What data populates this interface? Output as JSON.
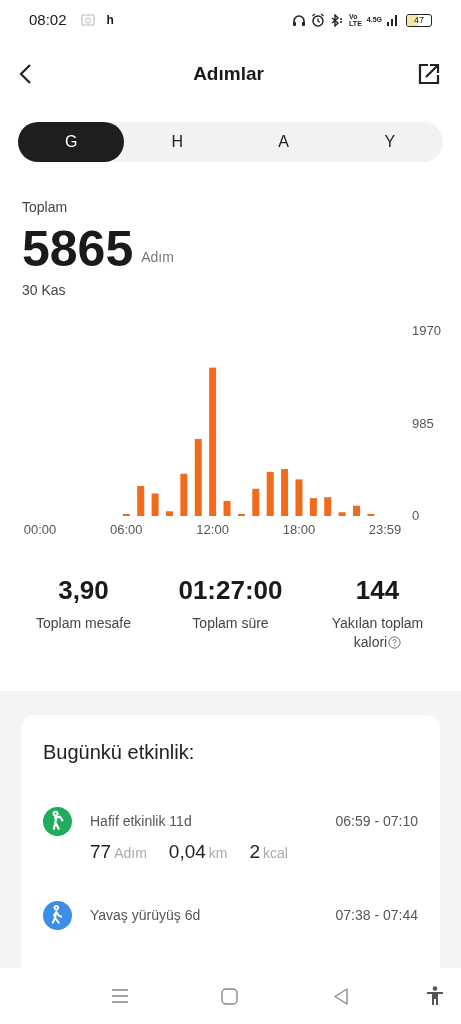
{
  "status_bar": {
    "time": "08:02",
    "notification": "h",
    "volte": [
      "Vo",
      "LTE"
    ],
    "network": "4.5G",
    "battery": "47"
  },
  "header": {
    "title": "Adımlar"
  },
  "tabs": [
    {
      "label": "G",
      "selected": true
    },
    {
      "label": "H",
      "selected": false
    },
    {
      "label": "A",
      "selected": false
    },
    {
      "label": "Y",
      "selected": false
    }
  ],
  "summary": {
    "label": "Toplam",
    "value": "5865",
    "unit": "Adım",
    "date": "30 Kas"
  },
  "chart_data": {
    "type": "bar",
    "x": [
      6,
      7,
      8,
      9,
      10,
      11,
      12,
      13,
      14,
      15,
      16,
      17,
      18,
      19,
      20,
      21,
      22,
      23
    ],
    "series": [
      {
        "color": "#f06b1c",
        "values": [
          20,
          320,
          240,
          50,
          450,
          820,
          1580,
          160,
          20,
          290,
          470,
          500,
          390,
          190,
          200,
          40,
          110,
          20
        ]
      }
    ],
    "xlim": [
      0,
      23.98
    ],
    "ylim": [
      0,
      1970
    ],
    "yticks": [
      {
        "value": 0,
        "label": "0"
      },
      {
        "value": 985,
        "label": "985"
      },
      {
        "value": 1970,
        "label": "1970"
      }
    ],
    "xticks": [
      {
        "value": 0,
        "label": "00:00"
      },
      {
        "value": 6,
        "label": "06:00"
      },
      {
        "value": 12,
        "label": "12:00"
      },
      {
        "value": 18,
        "label": "18:00"
      },
      {
        "value": 23.98,
        "label": "23:59"
      }
    ]
  },
  "stats": [
    {
      "value": "3,90",
      "label": "Toplam mesafe"
    },
    {
      "value": "01:27:00",
      "label": "Toplam süre"
    },
    {
      "value": "144",
      "label": "Yakılan toplam kalori",
      "info": true
    }
  ],
  "activity": {
    "title": "Bugünkü etkinlik:",
    "items": [
      {
        "kind": "light",
        "title": "Hafif etkinlik 11d",
        "time": "06:59 - 07:10",
        "color": "#1fad5c",
        "stats": [
          {
            "value": "77",
            "unit": "Adım"
          },
          {
            "value": "0,04",
            "unit": "km"
          },
          {
            "value": "2",
            "unit": "kcal"
          }
        ]
      },
      {
        "kind": "walk",
        "title": "Yavaş yürüyüş 6d",
        "time": "07:38 - 07:44",
        "color": "#3d8ee6"
      }
    ]
  }
}
